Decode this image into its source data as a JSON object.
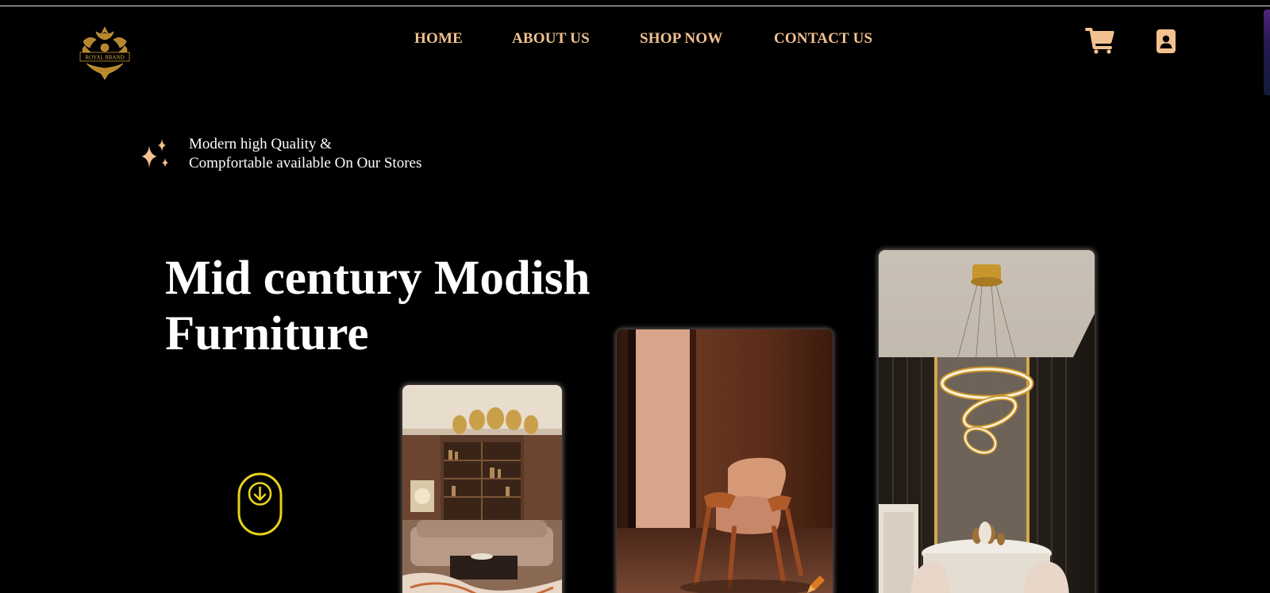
{
  "header": {
    "logo_text": "ROYAL BRAND",
    "nav": {
      "home": "HOME",
      "about": "ABOUT US",
      "shop": "SHOP NOW",
      "contact": "CONTACT US"
    },
    "icons": {
      "cart": "cart-icon",
      "account": "contact-card-icon"
    }
  },
  "tagline": {
    "line1": "Modern high Quality &",
    "line2": "Compfortable available On Our Stores",
    "icon": "sparkle-icon"
  },
  "hero": {
    "title_line1": "Mid century Modish",
    "title_line2": "Furniture"
  },
  "scroll_button": {
    "icon": "mouse-scroll-down-icon"
  },
  "gallery": [
    {
      "subject": "living room with sofa and bookshelves"
    },
    {
      "subject": "leather lounge chair"
    },
    {
      "subject": "dining room with ring chandelier"
    }
  ],
  "colors": {
    "background": "#000000",
    "nav_text": "#f2c18f",
    "accent_gold": "#c9962e",
    "scroll_yellow": "#e8d21e",
    "text": "#ffffff"
  }
}
